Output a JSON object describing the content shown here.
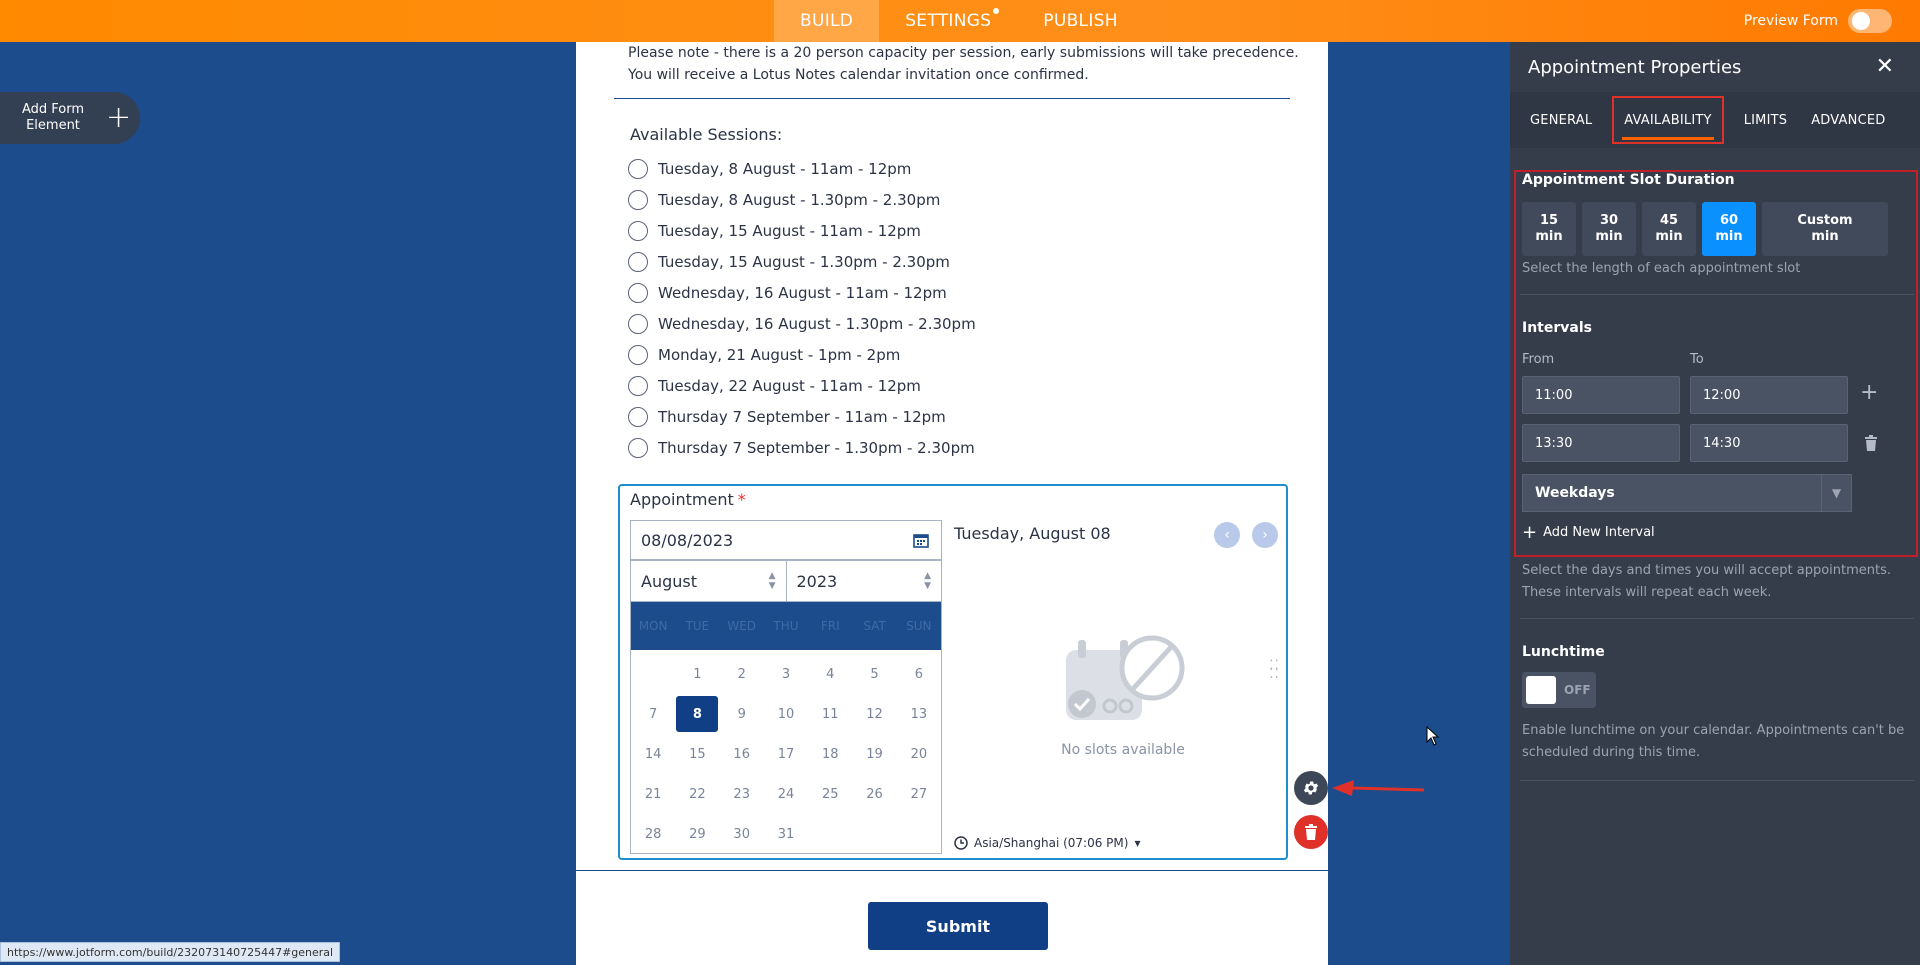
{
  "topbar": {
    "tabs": [
      {
        "label": "BUILD",
        "active": true
      },
      {
        "label": "SETTINGS",
        "active": false,
        "has_dot": true
      },
      {
        "label": "PUBLISH",
        "active": false
      }
    ],
    "preview_label": "Preview Form"
  },
  "add_element": {
    "label": "Add Form Element"
  },
  "form": {
    "note_line1": "Please note - there is a 20 person capacity per session, early submissions will take precedence.",
    "note_line2": "You will receive a Lotus Notes calendar invitation once confirmed.",
    "sessions_title": "Available Sessions:",
    "sessions": [
      "Tuesday, 8 August - 11am - 12pm",
      "Tuesday, 8 August - 1.30pm - 2.30pm",
      "Tuesday, 15 August - 11am - 12pm",
      "Tuesday, 15 August - 1.30pm - 2.30pm",
      "Wednesday, 16 August - 11am - 12pm",
      "Wednesday, 16 August - 1.30pm - 2.30pm",
      "Monday, 21 August - 1pm - 2pm",
      "Tuesday, 22 August - 11am - 12pm",
      "Thursday 7 September - 11am - 12pm",
      "Thursday 7 September - 1.30pm - 2.30pm"
    ],
    "appointment": {
      "label": "Appointment",
      "required_mark": "*",
      "date_value": "08/08/2023",
      "month": "August",
      "year": "2023",
      "weekdays": [
        "MON",
        "TUE",
        "WED",
        "THU",
        "FRI",
        "SAT",
        "SUN"
      ],
      "days": [
        "",
        "1",
        "2",
        "3",
        "4",
        "5",
        "6",
        "7",
        "8",
        "9",
        "10",
        "11",
        "12",
        "13",
        "14",
        "15",
        "16",
        "17",
        "18",
        "19",
        "20",
        "21",
        "22",
        "23",
        "24",
        "25",
        "26",
        "27",
        "28",
        "29",
        "30",
        "31"
      ],
      "selected_day": "8",
      "slot_date": "Tuesday, August 08",
      "no_slots": "No slots available",
      "timezone": "Asia/Shanghai (07:06 PM)"
    },
    "submit_label": "Submit"
  },
  "status_url": "https://www.jotform.com/build/232073140725447#general",
  "panel": {
    "title": "Appointment Properties",
    "tabs": [
      {
        "label": "GENERAL",
        "active": false
      },
      {
        "label": "AVAILABILITY",
        "active": true
      },
      {
        "label": "LIMITS",
        "active": false
      },
      {
        "label": "ADVANCED",
        "active": false
      }
    ],
    "slot_duration": {
      "title": "Appointment Slot Duration",
      "options": [
        {
          "value": "15",
          "unit": "min",
          "selected": false
        },
        {
          "value": "30",
          "unit": "min",
          "selected": false
        },
        {
          "value": "45",
          "unit": "min",
          "selected": false
        },
        {
          "value": "60",
          "unit": "min",
          "selected": true
        },
        {
          "value": "Custom",
          "unit": "min",
          "selected": false
        }
      ],
      "hint": "Select the length of each appointment slot"
    },
    "intervals": {
      "title": "Intervals",
      "from_label": "From",
      "to_label": "To",
      "rows": [
        {
          "from": "11:00",
          "to": "12:00"
        },
        {
          "from": "13:30",
          "to": "14:30"
        }
      ],
      "days": "Weekdays",
      "add_label": "Add New Interval",
      "hint_line1": "Select the days and times you will accept appointments.",
      "hint_line2": "These intervals will repeat each week."
    },
    "lunchtime": {
      "title": "Lunchtime",
      "toggle_label": "OFF",
      "hint_line1": "Enable lunchtime on your calendar. Appointments can't be",
      "hint_line2": "scheduled during this time."
    }
  },
  "colors": {
    "topbar_orange": "#ff8a00",
    "canvas_blue": "#1c4c8c",
    "panel_dark": "#353d4b",
    "selected_duration": "#0a91ff",
    "highlight_red": "#c0202a"
  }
}
